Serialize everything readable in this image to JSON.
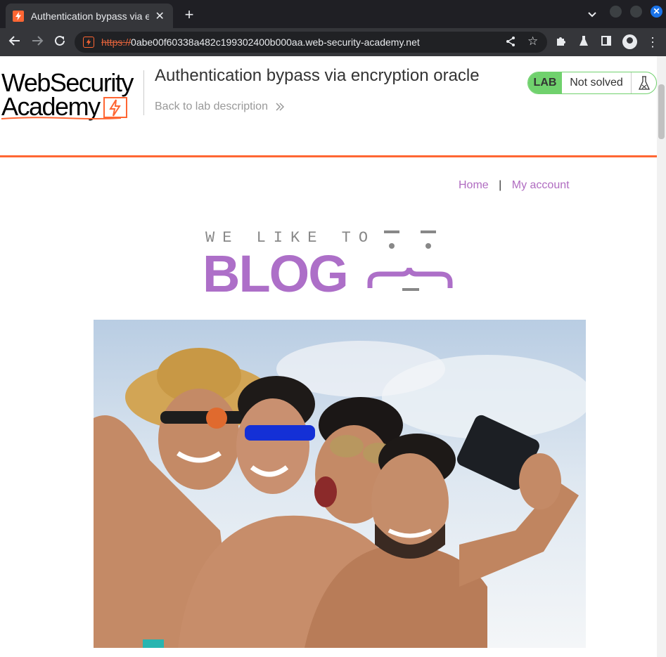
{
  "browser": {
    "tab_title": "Authentication bypass via encryption oracle",
    "url_scheme": "https://",
    "url_host": "0abe00f60338a482c199302400b000aa.web-security-academy.net"
  },
  "lab": {
    "logo_line1": "WebSecurity",
    "logo_line2": "Academy",
    "title": "Authentication bypass via encryption oracle",
    "back_link": "Back to lab description",
    "badge": "LAB",
    "status": "Not solved"
  },
  "nav": {
    "home": "Home",
    "separator": "|",
    "my_account": "My account"
  },
  "blog_logo": {
    "tagline": "WE LIKE TO",
    "word": "BLOG"
  },
  "colors": {
    "accent_orange": "#ff6633",
    "lab_green": "#70d16d",
    "link_purple": "#b06cc1",
    "blog_purple": "#ad6fc8"
  }
}
